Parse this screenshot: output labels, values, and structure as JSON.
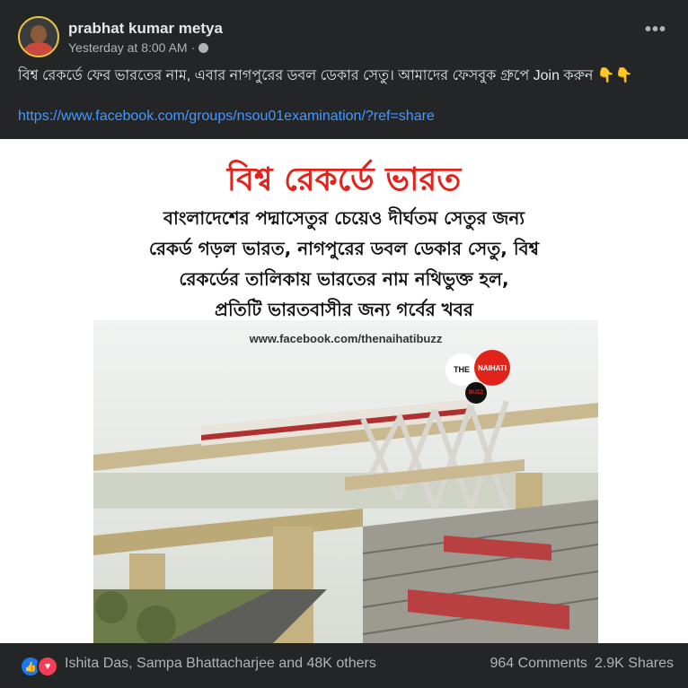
{
  "post": {
    "author": "prabhat kumar metya",
    "timestamp": "Yesterday at 8:00 AM",
    "separator": "·",
    "privacy_icon": "globe-icon",
    "more_icon": "more-options-icon",
    "text": "বিশ্ব রেকর্ডে ফের ভারতের নাম, এবার নাগপুরের ডবল ডেকার সেতু। আমাদের ফেসবুক গ্রুপে Join করুন 👇👇",
    "link": "https://www.facebook.com/groups/nsou01examination/?ref=share"
  },
  "image": {
    "title": "বিশ্ব রেকর্ডে ভারত",
    "lines": [
      "বাংলাদেশের পদ্মাসেতুর চেয়েও দীর্ঘতম সেতুর জন্য",
      "রেকর্ড গড়ল ভারত, নাগপুরের ডবল ডেকার সেতু, বিশ্ব",
      "রেকর্ডের তালিকায় ভারতের নাম নথিভুক্ত হল,",
      "প্রতিটি ভারতবাসীর জন্য গর্বের খবর"
    ],
    "watermark": "www.facebook.com/thenaihatibuzz",
    "logo": {
      "the": "THE",
      "naihati": "NAIHATI",
      "buzz": "BUZZ"
    }
  },
  "footer": {
    "reaction_icons": [
      "like-icon",
      "love-icon"
    ],
    "reactors": "Ishita Das, Sampa Bhattacharjee and 48K others",
    "comments": "964 Comments",
    "shares": "2.9K Shares"
  },
  "colors": {
    "background": "#242526",
    "text": "#e4e6eb",
    "secondary": "#b0b3b8",
    "link": "#4599ff",
    "title_red": "#e0241c"
  }
}
